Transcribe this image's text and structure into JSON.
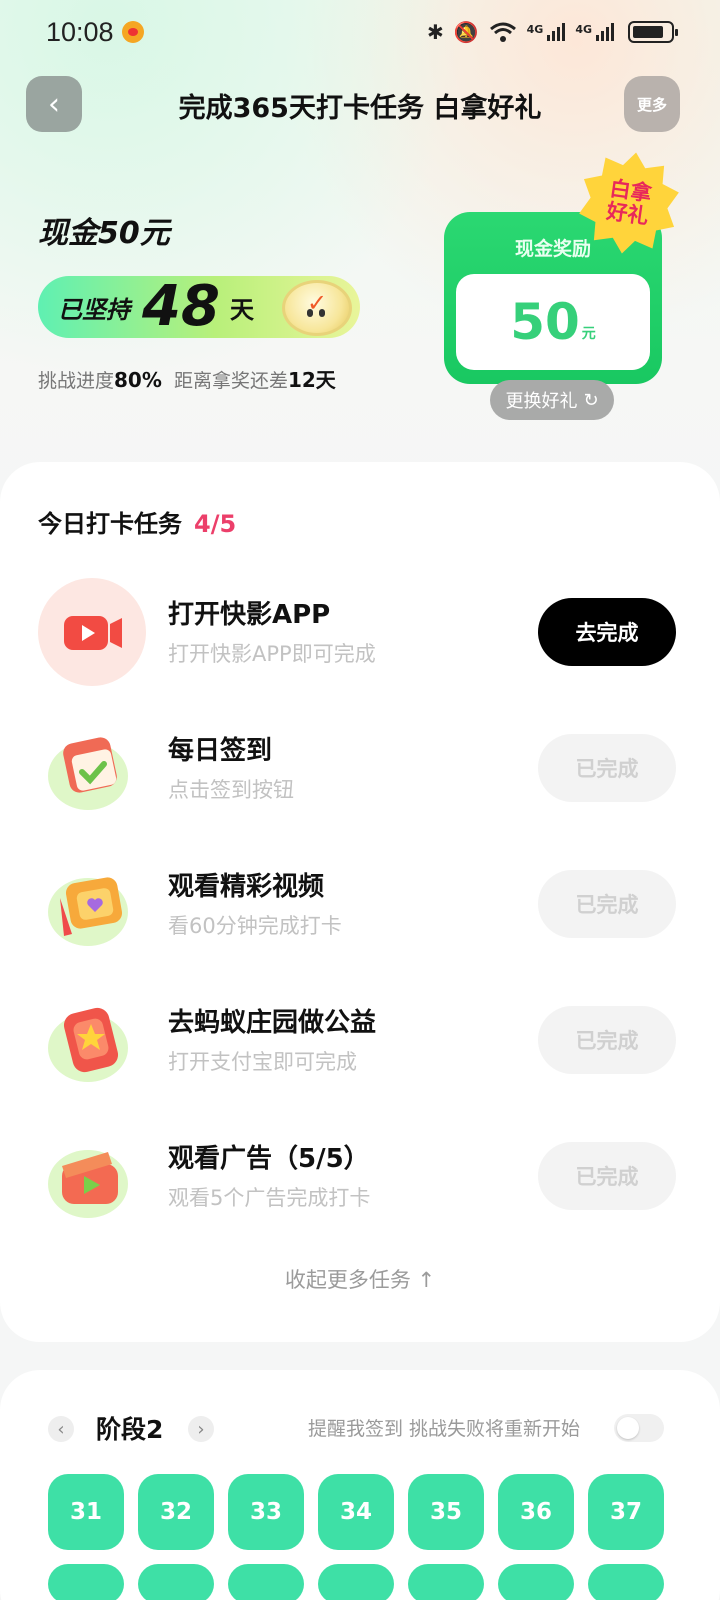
{
  "status_bar": {
    "time": "10:08",
    "net1": "4G",
    "net2": "4G"
  },
  "header": {
    "back_icon": "chevron-left-icon",
    "title": "完成365天打卡任务 白拿好礼",
    "more_label": "更多"
  },
  "hero": {
    "amount": "现金50元",
    "streak_prefix": "已坚持",
    "streak_days": "48",
    "streak_suffix": "天",
    "progress_label": "挑战进度",
    "progress_percent": "80%",
    "remaining_label": "距离拿奖还差",
    "remaining_days": "12天"
  },
  "reward": {
    "label": "现金奖励",
    "value": "50",
    "unit": "元",
    "badge": "白拿好礼",
    "swap_label": "更换好礼"
  },
  "tasks": {
    "heading": "今日打卡任务",
    "progress": "4/5",
    "items": [
      {
        "title": "打开快影APP",
        "subtitle": "打开快影APP即可完成",
        "button": "去完成",
        "done": false,
        "icon": "video-camera-icon"
      },
      {
        "title": "每日签到",
        "subtitle": "点击签到按钮",
        "button": "已完成",
        "done": true,
        "icon": "calendar-check-icon"
      },
      {
        "title": "观看精彩视频",
        "subtitle": "看60分钟完成打卡",
        "button": "已完成",
        "done": true,
        "icon": "heart-screen-icon"
      },
      {
        "title": "去蚂蚁庄园做公益",
        "subtitle": "打开支付宝即可完成",
        "button": "已完成",
        "done": true,
        "icon": "star-phone-icon"
      },
      {
        "title": "观看广告（5/5）",
        "subtitle": "观看5个广告完成打卡",
        "button": "已完成",
        "done": true,
        "icon": "play-clapper-icon"
      }
    ],
    "collapse_label": "收起更多任务 ↑"
  },
  "stage": {
    "title": "阶段2",
    "remind_text": "提醒我签到 挑战失败将重新开始",
    "reminder_on": false,
    "days": [
      "31",
      "32",
      "33",
      "34",
      "35",
      "36",
      "37"
    ]
  },
  "colors": {
    "accent_green": "#2bd872",
    "accent_pink": "#ec3f6a",
    "day_green": "#3ee0a6"
  }
}
